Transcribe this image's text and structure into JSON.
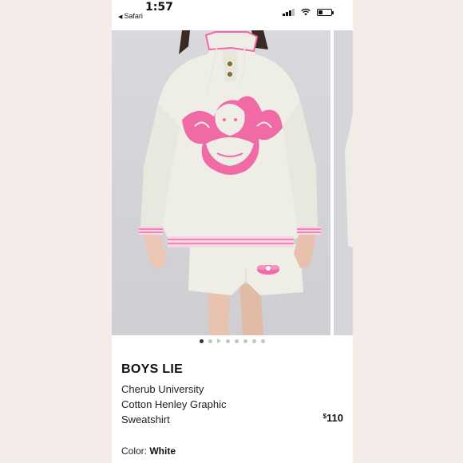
{
  "status_bar": {
    "time": "1:57",
    "back_app": "Safari"
  },
  "gallery": {
    "image_count": 8,
    "active_index": 0,
    "video_index": 2
  },
  "product": {
    "brand": "BOYS LIE",
    "title_lines": [
      "Cherub University",
      "Cotton Henley Graphic",
      "Sweatshirt"
    ],
    "price_currency": "$",
    "price_value": "110",
    "color_label": "Color:",
    "color_value": "White"
  },
  "colors": {
    "accent_pink": "#f06aa6",
    "garment_cream": "#efeee6"
  }
}
